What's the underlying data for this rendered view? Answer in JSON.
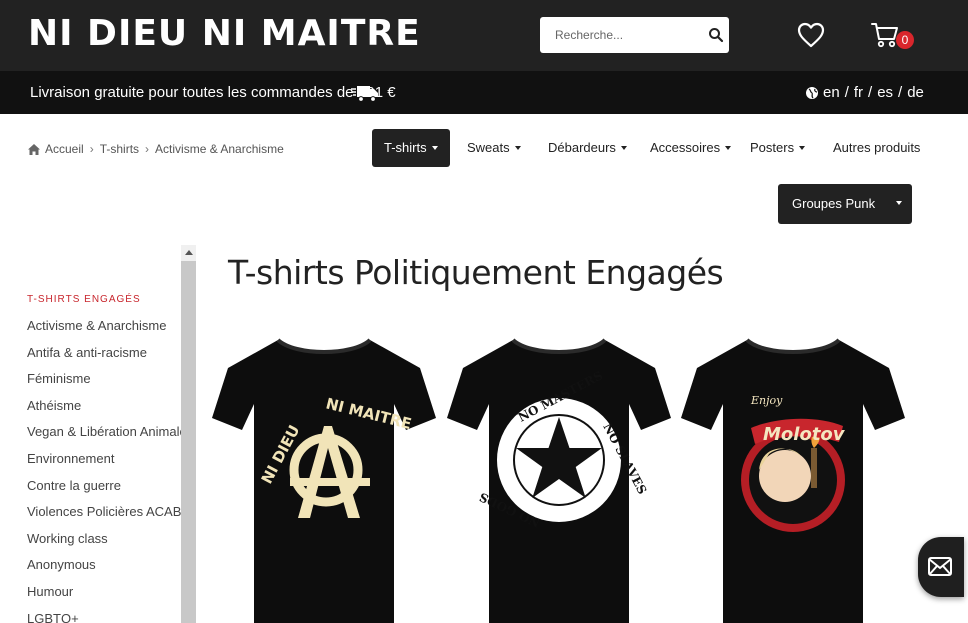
{
  "header": {
    "logo": "NI DIEU NI MAITRE",
    "search_placeholder": "Recherche...",
    "cart_count": "0"
  },
  "shipping": {
    "text": "Livraison gratuite pour toutes les commandes de +91 €",
    "languages": [
      "en",
      "fr",
      "es",
      "de"
    ]
  },
  "breadcrumb": [
    "Accueil",
    "T-shirts",
    "Activisme & Anarchisme"
  ],
  "nav": {
    "items": [
      {
        "label": "T-shirts",
        "dropdown": true,
        "active": true
      },
      {
        "label": "Sweats",
        "dropdown": true
      },
      {
        "label": "Débardeurs",
        "dropdown": true
      },
      {
        "label": "Accessoires",
        "dropdown": true
      },
      {
        "label": "Posters",
        "dropdown": true
      },
      {
        "label": "Autres produits",
        "dropdown": false
      }
    ],
    "punk_label": "Groupes Punk"
  },
  "sidebar": {
    "heading": "T-SHIRTS ENGAGÉS",
    "items": [
      "Activisme & Anarchisme",
      "Antifa & anti-racisme",
      "Féminisme",
      "Athéisme",
      "Vegan & Libération Animale",
      "Environnement",
      "Contre la guerre",
      "Violences Policières ACAB",
      "Working class",
      "Anonymous",
      "Humour",
      "LGBTQ+"
    ]
  },
  "main": {
    "title": "T-shirts Politiquement Engagés",
    "products": [
      {
        "print_top": "NI DIEU",
        "print_right": "NI MAITRE"
      },
      {
        "print_top": "NO MASTERS",
        "print_right": "NO SLAVES",
        "print_bottom": "NO GODS"
      },
      {
        "print_top": "Enjoy",
        "print_mid": "Molotov"
      }
    ]
  },
  "colors": {
    "header_bg": "#222222",
    "shipbar_bg": "#111111",
    "accent_red": "#c8262d",
    "badge_red": "#d9262c"
  }
}
